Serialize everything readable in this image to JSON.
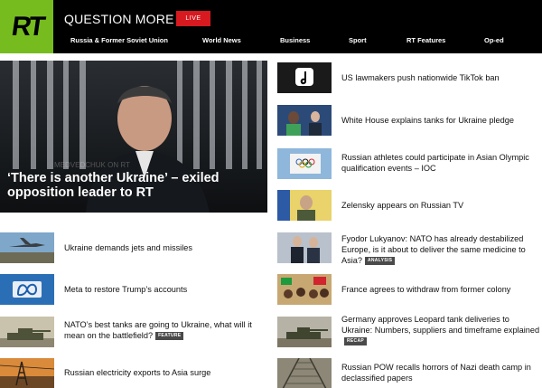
{
  "header": {
    "logo_text": "RT",
    "tagline": "QUESTION MORE",
    "live_label": "LIVE",
    "accent_color": "#77bc1f",
    "live_color": "#d71920"
  },
  "nav": [
    {
      "label": "Russia & Former Soviet Union"
    },
    {
      "label": "World News"
    },
    {
      "label": "Business"
    },
    {
      "label": "Sport"
    },
    {
      "label": "RT Features"
    },
    {
      "label": "Op-ed"
    }
  ],
  "hero": {
    "title": "‘There is another Ukraine’ – exiled opposition leader to RT"
  },
  "left_news": [
    {
      "title": "Ukraine demands jets and missiles",
      "badge": ""
    },
    {
      "title": "Meta to restore Trump’s accounts",
      "badge": ""
    },
    {
      "title": "NATO’s best tanks are going to Ukraine, what will it mean on the battlefield?",
      "badge": "FEATURE"
    },
    {
      "title": "Russian electricity exports to Asia surge",
      "badge": ""
    }
  ],
  "right_news": [
    {
      "title": "US lawmakers push nationwide TikTok ban",
      "badge": ""
    },
    {
      "title": "White House explains tanks for Ukraine pledge",
      "badge": ""
    },
    {
      "title": "Russian athletes could participate in Asian Olympic qualification events – IOC",
      "badge": ""
    },
    {
      "title": "Zelensky appears on Russian TV",
      "badge": ""
    },
    {
      "title": "Fyodor Lukyanov: NATO has already destabilized Europe, is it about to deliver the same medicine to Asia?",
      "badge": "ANALYSIS"
    },
    {
      "title": "France agrees to withdraw from former colony",
      "badge": ""
    },
    {
      "title": "Germany approves Leopard tank deliveries to Ukraine: Numbers, suppliers and timeframe explained",
      "badge": "RECAP"
    },
    {
      "title": "Russian POW recalls horrors of Nazi death camp in declassified papers",
      "badge": ""
    }
  ]
}
